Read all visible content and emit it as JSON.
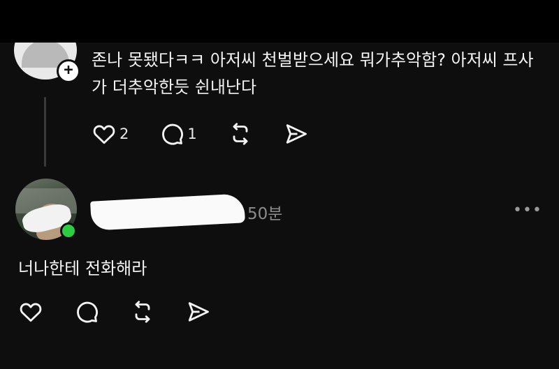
{
  "post1": {
    "text": "존나 못됐다ㅋㅋ 아저씨 천벌받으세요 뭐가추악함? 아저씨 프사가 더추악한듯 쉰내난다",
    "likes": "2",
    "replies": "1",
    "icons": [
      "heart-icon",
      "comment-icon",
      "repost-icon",
      "share-icon"
    ]
  },
  "post2": {
    "time": "50분",
    "more": "•••",
    "text": "너나한테 전화해라",
    "online_color": "#2ecc40",
    "icons": [
      "heart-icon",
      "comment-icon",
      "repost-icon",
      "share-icon"
    ]
  },
  "avatar1": {
    "badge": "+"
  }
}
